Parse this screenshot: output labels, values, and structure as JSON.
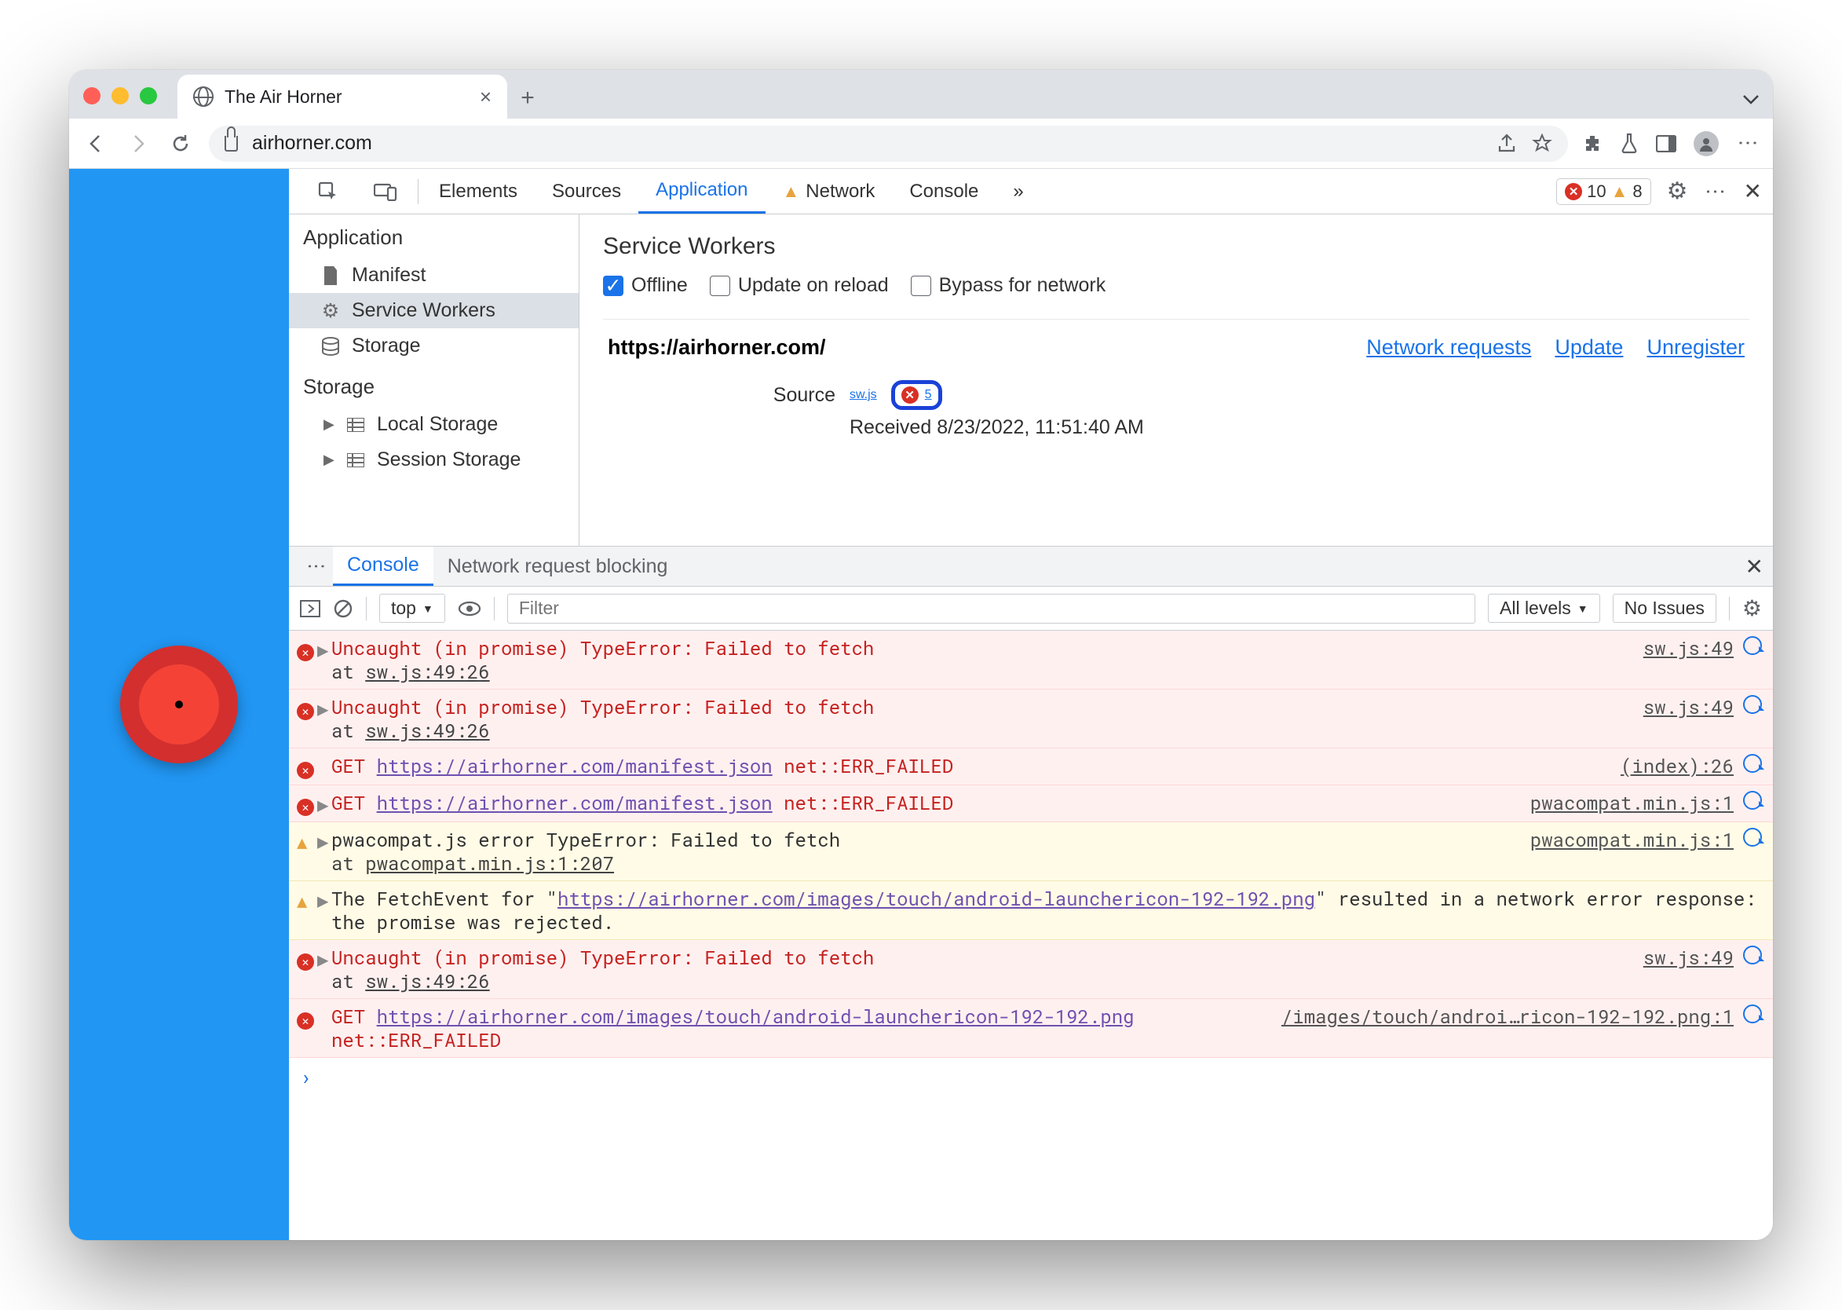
{
  "tab": {
    "title": "The Air Horner"
  },
  "omnibox": {
    "url": "airhorner.com"
  },
  "devtools": {
    "panels": [
      "Elements",
      "Sources",
      "Application",
      "Network",
      "Console"
    ],
    "active_panel": "Application",
    "error_count": "10",
    "warning_count": "8"
  },
  "sidebar": {
    "sec1": "Application",
    "manifest": "Manifest",
    "sw": "Service Workers",
    "storage": "Storage",
    "sec2": "Storage",
    "local": "Local Storage",
    "session": "Session Storage"
  },
  "sw": {
    "title": "Service Workers",
    "offline": "Offline",
    "update_reload": "Update on reload",
    "bypass": "Bypass for network",
    "origin": "https://airhorner.com/",
    "link_net": "Network requests",
    "link_upd": "Update",
    "link_unreg": "Unregister",
    "source_label": "Source",
    "source_file": "sw.js",
    "err_count": "5",
    "received_label": "Received",
    "received_value": "8/23/2022, 11:51:40 AM"
  },
  "drawer": {
    "console": "Console",
    "nrb": "Network request blocking"
  },
  "cons_tb": {
    "context": "top",
    "filter_ph": "Filter",
    "levels": "All levels",
    "issues": "No Issues"
  },
  "console": [
    {
      "type": "err",
      "expand": true,
      "text": "Uncaught (in promise) TypeError: Failed to fetch",
      "sub_pre": "    at ",
      "sub_link": "sw.js:49:26",
      "src": "sw.js:49"
    },
    {
      "type": "err",
      "expand": true,
      "text": "Uncaught (in promise) TypeError: Failed to fetch",
      "sub_pre": "    at ",
      "sub_link": "sw.js:49:26",
      "src": "sw.js:49"
    },
    {
      "type": "err",
      "expand": false,
      "pre": "GET ",
      "link": "https://airhorner.com/manifest.json",
      "post": " net::ERR_FAILED",
      "src": "(index):26"
    },
    {
      "type": "err",
      "expand": true,
      "pre": "GET ",
      "link": "https://airhorner.com/manifest.json",
      "post": " net::ERR_FAILED",
      "src": "pwacompat.min.js:1"
    },
    {
      "type": "warn",
      "expand": true,
      "text": "pwacompat.js error TypeError: Failed to fetch",
      "sub_pre": "    at ",
      "sub_link": "pwacompat.min.js:1:207",
      "src": "pwacompat.min.js:1"
    },
    {
      "type": "warn",
      "expand": true,
      "pre": "The FetchEvent for \"",
      "link": "https://airhorner.com/images/touch/android-launchericon-192-192.png",
      "post": "\" resulted in a network error response: the promise was rejected.",
      "src": ""
    },
    {
      "type": "err",
      "expand": true,
      "text": "Uncaught (in promise) TypeError: Failed to fetch",
      "sub_pre": "    at ",
      "sub_link": "sw.js:49:26",
      "src": "sw.js:49"
    },
    {
      "type": "err",
      "expand": false,
      "pre": "GET ",
      "link": "https://airhorner.com/images/touch/android-launchericon-192-192.png",
      "post": " net::ERR_FAILED",
      "src": "/images/touch/androi…ricon-192-192.png:1"
    }
  ]
}
